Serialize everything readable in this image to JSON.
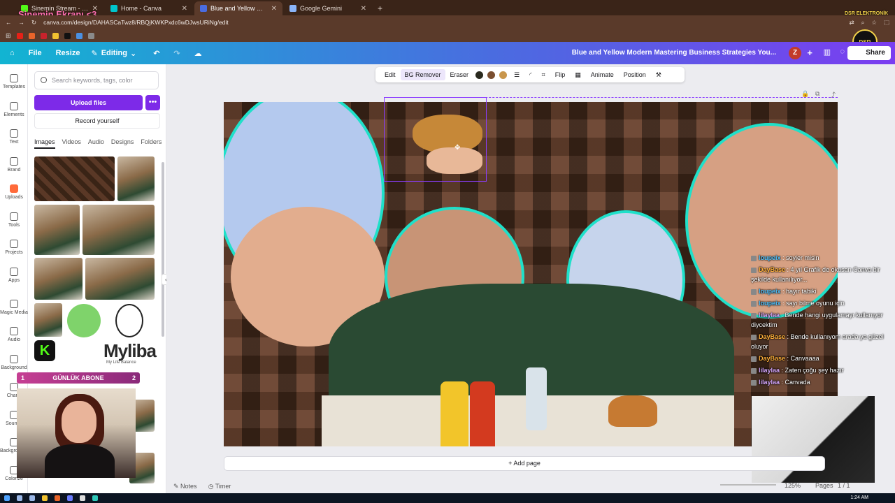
{
  "stream_overlay": {
    "title": "Sinemin Ekranı <3",
    "brand_badge": "DSR ELEKTRONİK",
    "brand_logo": "DSR",
    "subscriber_bar": {
      "left": "1",
      "label": "GÜNLÜK ABONE",
      "right": "2"
    }
  },
  "browser": {
    "tabs": [
      {
        "title": "Sinemin Stream - Watch Live on",
        "favicon_color": "#53fc18",
        "active": false
      },
      {
        "title": "Home - Canva",
        "favicon_color": "#00c4cc",
        "active": false
      },
      {
        "title": "Blue and Yellow Modern Maste",
        "favicon_color": "#4a6ce0",
        "active": true
      },
      {
        "title": "Google Gemini",
        "favicon_color": "#8ab4f8",
        "active": false
      }
    ],
    "new_tab": "+",
    "url": "canva.com/design/DAHASCaTwz8/RBQjKWKPxdc6wDJwsURiNg/edit"
  },
  "topbar": {
    "file": "File",
    "resize": "Resize",
    "editing": "Editing",
    "design_title": "Blue and Yellow Modern Mastering Business Strategies You...",
    "avatar": "Z",
    "share": "Share"
  },
  "rail": [
    {
      "label": "Templates",
      "icon": "templates-icon"
    },
    {
      "label": "Elements",
      "icon": "elements-icon"
    },
    {
      "label": "Text",
      "icon": "text-icon"
    },
    {
      "label": "Brand",
      "icon": "brand-icon"
    },
    {
      "label": "Uploads",
      "icon": "uploads-icon"
    },
    {
      "label": "Tools",
      "icon": "tools-icon"
    },
    {
      "label": "Projects",
      "icon": "projects-icon"
    },
    {
      "label": "Apps",
      "icon": "apps-icon"
    },
    {
      "label": "Magic Media",
      "icon": "magic-media-icon"
    },
    {
      "label": "Audio",
      "icon": "audio-icon"
    },
    {
      "label": "Background",
      "icon": "background-icon"
    },
    {
      "label": "Charts",
      "icon": "charts-icon"
    },
    {
      "label": "Sounds",
      "icon": "sounds-icon"
    },
    {
      "label": "Backgrounds",
      "icon": "backgrounds-icon"
    },
    {
      "label": "Colorize",
      "icon": "colorize-icon"
    }
  ],
  "panel": {
    "search_placeholder": "Search keywords, tags, color",
    "upload": "Upload files",
    "more": "•••",
    "record": "Record yourself",
    "tabs": [
      "Images",
      "Videos",
      "Audio",
      "Designs",
      "Folders"
    ],
    "brand_text": "Myliba",
    "brand_sub": "My Life Balance"
  },
  "context_toolbar": {
    "edit": "Edit",
    "bg_remover": "BG Remover",
    "eraser": "Eraser",
    "colors": [
      "#2a2a1e",
      "#7a4e30",
      "#c9964c"
    ],
    "flip": "Flip",
    "animate": "Animate",
    "position": "Position"
  },
  "canvas": {
    "add_page": "+ Add page"
  },
  "bottom": {
    "notes": "Notes",
    "timer": "Timer",
    "zoom": "125%",
    "pages_label": "Pages",
    "page_count": "1 / 1"
  },
  "chat": [
    {
      "user": "loupeix",
      "color": "#4fc3ff",
      "text": ": soyier misin"
    },
    {
      "user": "DayBase",
      "color": "#ffb03a",
      "text": ": 4 yıl Grafik de okusan Canva bir şekilde kullanılıyor..."
    },
    {
      "user": "loupeix",
      "color": "#4fc3ff",
      "text": ": hayır tabiki"
    },
    {
      "user": "loupeix",
      "color": "#4fc3ff",
      "text": ": sayı bilme oyunu için"
    },
    {
      "user": "lilaylaa",
      "color": "#d7a8ff",
      "text": ": Bende hangi uygulamayı kullanıyor diycektim"
    },
    {
      "user": "DayBase",
      "color": "#ffb03a",
      "text": ": Bende kullanıyom arada ya güzel oluyor"
    },
    {
      "user": "DayBase",
      "color": "#ffb03a",
      "text": ": Canvaaaa"
    },
    {
      "user": "lilaylaa",
      "color": "#d7a8ff",
      "text": ": Zaten çoğu şey hazır"
    },
    {
      "user": "lilaylaa",
      "color": "#d7a8ff",
      "text": ": Canvada"
    }
  ],
  "taskbar": {
    "time": "1:24 AM"
  }
}
